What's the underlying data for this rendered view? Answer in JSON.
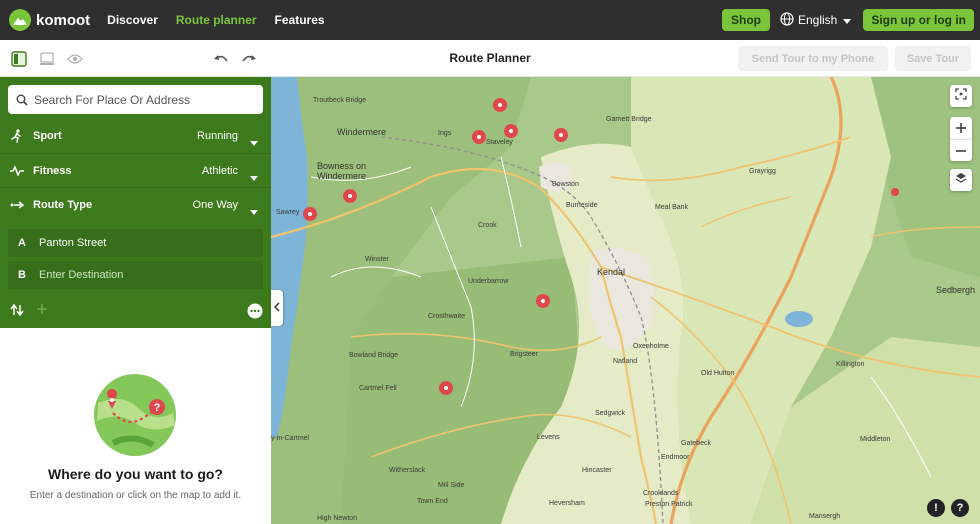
{
  "nav": {
    "logo_text": "komoot",
    "links": [
      "Discover",
      "Route planner",
      "Features"
    ],
    "shop_label": "Shop",
    "language_label": "English",
    "signup_label": "Sign up or log in"
  },
  "toolbar": {
    "title": "Route Planner",
    "send_label": "Send Tour to my Phone",
    "save_label": "Save Tour"
  },
  "sidebar": {
    "search_placeholder": "Search For Place Or Address",
    "sport": {
      "label": "Sport",
      "value": "Running"
    },
    "fitness": {
      "label": "Fitness",
      "value": "Athletic"
    },
    "route_type": {
      "label": "Route Type",
      "value": "One Way"
    },
    "waypoints": [
      {
        "letter": "A",
        "text": "Panton Street"
      },
      {
        "letter": "B",
        "text": "Enter Destination"
      }
    ],
    "empty_title": "Where do you want to go?",
    "empty_subtitle": "Enter a destination or click on the map to add it."
  },
  "map": {
    "places": [
      {
        "name": "Troutbeck Bridge"
      },
      {
        "name": "Windermere",
        "town": true
      },
      {
        "name": "Ings"
      },
      {
        "name": "Staveley"
      },
      {
        "name": "Garnett Bridge"
      },
      {
        "name": "Bowness on Windermere",
        "town": true
      },
      {
        "name": "Sawrey"
      },
      {
        "name": "Bowston"
      },
      {
        "name": "Burneside"
      },
      {
        "name": "Meal Bank"
      },
      {
        "name": "Grayrigg"
      },
      {
        "name": "Crook"
      },
      {
        "name": "Winster"
      },
      {
        "name": "Kendal",
        "town": true
      },
      {
        "name": "Underbarrow"
      },
      {
        "name": "Sedbergh",
        "town": true
      },
      {
        "name": "Crosthwaite"
      },
      {
        "name": "Oxenholme"
      },
      {
        "name": "Natland"
      },
      {
        "name": "Bowland Bridge"
      },
      {
        "name": "Brigsteer"
      },
      {
        "name": "Killington"
      },
      {
        "name": "Cartmel Fell"
      },
      {
        "name": "Old Hutton"
      },
      {
        "name": "Sedgwick"
      },
      {
        "name": "y-in-Cartmel"
      },
      {
        "name": "Levens"
      },
      {
        "name": "Gatebeck"
      },
      {
        "name": "Middleton"
      },
      {
        "name": "Endmoor"
      },
      {
        "name": "Hincaster"
      },
      {
        "name": "Witherslack"
      },
      {
        "name": "Crooklands"
      },
      {
        "name": "Mill Side"
      },
      {
        "name": "Preston Patrick"
      },
      {
        "name": "Heversham"
      },
      {
        "name": "Town End"
      },
      {
        "name": "Mansergh"
      },
      {
        "name": "High Newton"
      }
    ]
  },
  "colors": {
    "brand_green": "#7bc53b",
    "panel_green": "#3d7a1c",
    "poi_red": "#e0474c"
  }
}
